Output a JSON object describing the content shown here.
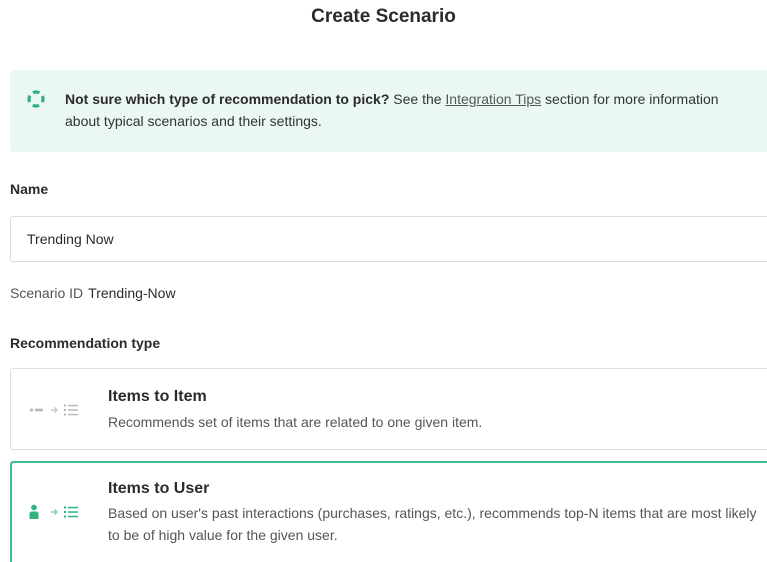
{
  "page": {
    "title": "Create Scenario"
  },
  "tip": {
    "bold_text": "Not sure which type of recommendation to pick?",
    "text_before_link": " See the ",
    "link_text": "Integration Tips",
    "text_after_link": " section for more information about typical scenarios and their settings.",
    "icon": "lifebuoy-icon",
    "accent_color": "#2fb37f",
    "background_color": "#eaf7f2"
  },
  "form": {
    "name_label": "Name",
    "name_value": "Trending Now",
    "scenario_id_label": "Scenario ID",
    "scenario_id_value": "Trending-Now",
    "recommendation_type_label": "Recommendation type"
  },
  "recommendation_types": [
    {
      "title": "Items to Item",
      "description": "Recommends set of items that are related to one given item.",
      "icon": "item-to-list-icon",
      "selected": false
    },
    {
      "title": "Items to User",
      "description": "Based on user's past interactions (purchases, ratings, etc.), recommends top-N items that are most likely to be of high value for the given user.",
      "icon": "user-to-list-icon",
      "selected": true
    }
  ],
  "colors": {
    "selected_border": "#3dbd91",
    "icon_gray": "#b8b8b8",
    "icon_green": "#2fb37f"
  }
}
